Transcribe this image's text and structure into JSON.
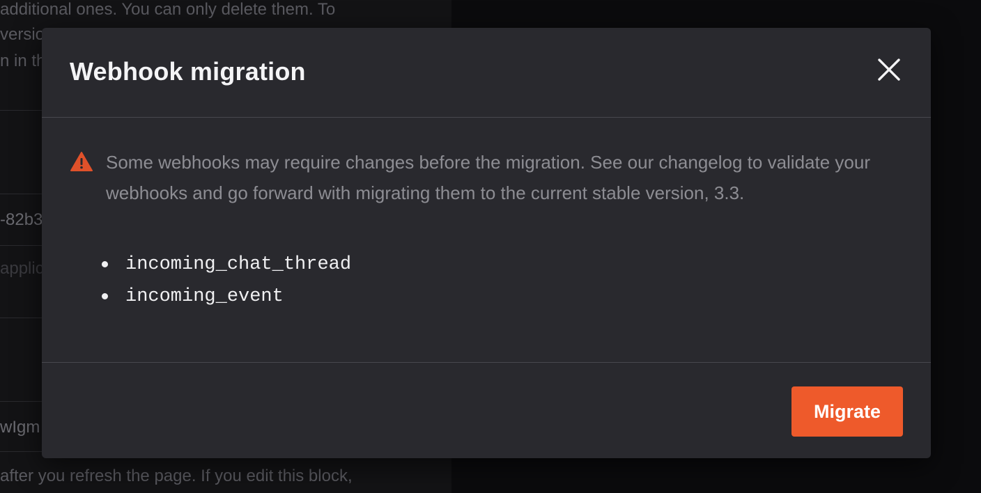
{
  "background": {
    "text_line_1": "additional ones. You can only delete them. To",
    "text_line_2": "versio",
    "text_line_3": "n in th",
    "id_fragment": "-82b3",
    "placeholder_fragment": "applic",
    "secret_fragment": "wIgm",
    "bottom_text": "after you refresh the page. If you edit this block,"
  },
  "modal": {
    "title": "Webhook migration",
    "close_icon": "close-icon",
    "warning_icon": "warning-triangle-icon",
    "warning_text": "Some webhooks may require changes before the migration. See our changelog to validate your webhooks and go forward with migrating them to the current stable version, 3.3.",
    "webhooks": [
      "incoming_chat_thread",
      "incoming_event"
    ],
    "migrate_label": "Migrate"
  },
  "colors": {
    "accent": "#ee5a2b",
    "warning": "#e0512a",
    "modal_bg": "#29292e"
  }
}
